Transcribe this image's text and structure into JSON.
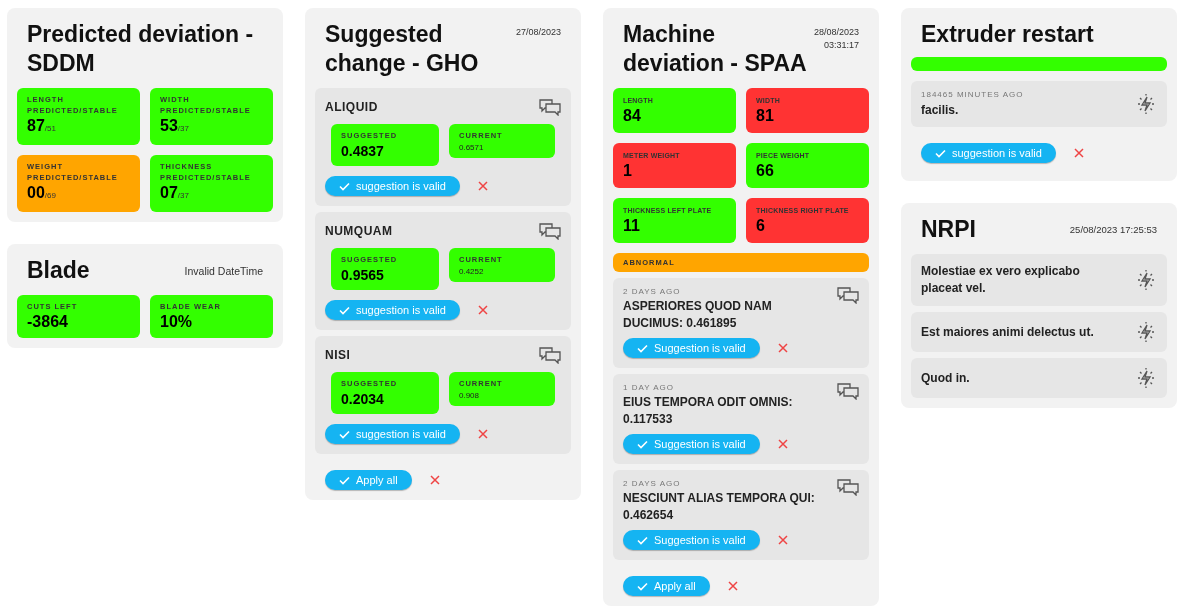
{
  "predicted_deviation": {
    "title": "Predicted deviation - SDDM",
    "tiles": [
      {
        "label": "LENGTH PREDICTED/STABLE",
        "value": "87",
        "stable": "/51",
        "color": "#33ff00"
      },
      {
        "label": "WIDTH PREDICTED/STABLE",
        "value": "53",
        "stable": "/37",
        "color": "#33ff00"
      },
      {
        "label": "WEIGHT PREDICTED/STABLE",
        "value": "00",
        "stable": "/69",
        "color": "#ffa500"
      },
      {
        "label": "THICKNESS PREDICTED/STABLE",
        "value": "07",
        "stable": "/37",
        "color": "#33ff00"
      }
    ]
  },
  "blade": {
    "title": "Blade",
    "timestamp": "Invalid DateTime",
    "tiles": [
      {
        "label": "CUTS LEFT",
        "value": "-3864",
        "color": "#33ff00"
      },
      {
        "label": "BLADE WEAR",
        "value": "10%",
        "color": "#33ff00"
      }
    ]
  },
  "suggested_change": {
    "title": "Suggested change - GHO",
    "timestamp": "27/08/2023",
    "items": [
      {
        "name": "ALIQUID",
        "suggested_label": "SUGGESTED",
        "suggested": "0.4837",
        "current_label": "CURRENT",
        "current": "0.6571",
        "button": "suggestion is valid"
      },
      {
        "name": "NUMQUAM",
        "suggested_label": "SUGGESTED",
        "suggested": "0.9565",
        "current_label": "CURRENT",
        "current": "0.4252",
        "button": "suggestion is valid"
      },
      {
        "name": "NISI",
        "suggested_label": "SUGGESTED",
        "suggested": "0.2034",
        "current_label": "CURRENT",
        "current": "0.908",
        "button": "suggestion is valid"
      }
    ],
    "apply_button": "Apply all"
  },
  "machine_deviation": {
    "title": "Machine deviation - SPAA",
    "date": "28/08/2023",
    "time": "03:31:17",
    "tiles": [
      {
        "label": "LENGTH",
        "value": "84",
        "color": "#33ff00"
      },
      {
        "label": "WIDTH",
        "value": "81",
        "color": "#ff3333"
      },
      {
        "label": "METER WEIGHT",
        "value": "1",
        "color": "#ff3333"
      },
      {
        "label": "PIECE WEIGHT",
        "value": "66",
        "color": "#33ff00"
      },
      {
        "label": "THICKNESS LEFT PLATE",
        "value": "11",
        "color": "#33ff00"
      },
      {
        "label": "THICKNESS RIGHT PLATE",
        "value": "6",
        "color": "#ff3333"
      }
    ],
    "status": {
      "label": "ABNORMAL",
      "color": "#ffa500"
    },
    "items": [
      {
        "time": "2 DAYS AGO",
        "text": "ASPERIORES QUOD NAM DUCIMUS: 0.461895",
        "button": "Suggestion is valid"
      },
      {
        "time": "1 DAY AGO",
        "text": "EIUS TEMPORA ODIT OMNIS: 0.117533",
        "button": "Suggestion is valid"
      },
      {
        "time": "2 DAYS AGO",
        "text": "NESCIUNT ALIAS TEMPORA QUI: 0.462654",
        "button": "Suggestion is valid"
      }
    ],
    "apply_button": "Apply all"
  },
  "extruder_restart": {
    "title": "Extruder restart",
    "item": {
      "time": "184465 MINUTES AGO",
      "text": "facilis."
    },
    "button": "suggestion is valid"
  },
  "nrpi": {
    "title": "NRPI",
    "timestamp": "25/08/2023 17:25:53",
    "items": [
      {
        "text": "Molestiae ex vero explicabo placeat vel."
      },
      {
        "text": "Est maiores animi delectus ut."
      },
      {
        "text": "Quod in."
      }
    ]
  }
}
